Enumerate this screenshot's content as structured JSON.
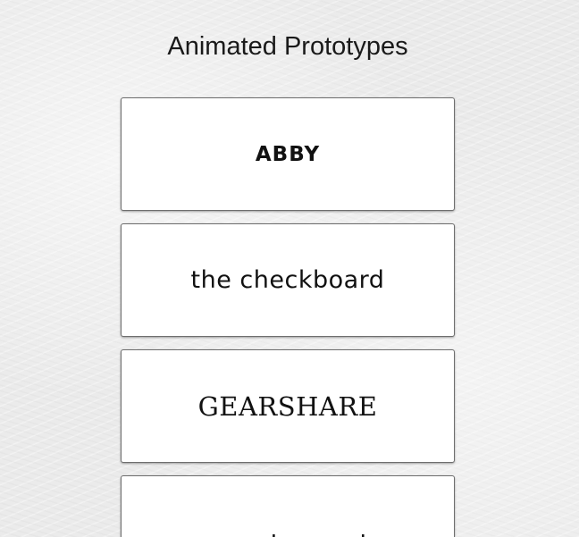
{
  "page": {
    "title": "Animated Prototypes"
  },
  "prototypes": [
    {
      "label": "ABBY"
    },
    {
      "label": "the checkboard"
    },
    {
      "label": "GEARSHARE"
    },
    {
      "label": "novel+novel"
    }
  ],
  "colors": {
    "background": "#ebebeb",
    "card": "#ffffff",
    "card_border": "#6e6e6e",
    "text": "#111111"
  }
}
